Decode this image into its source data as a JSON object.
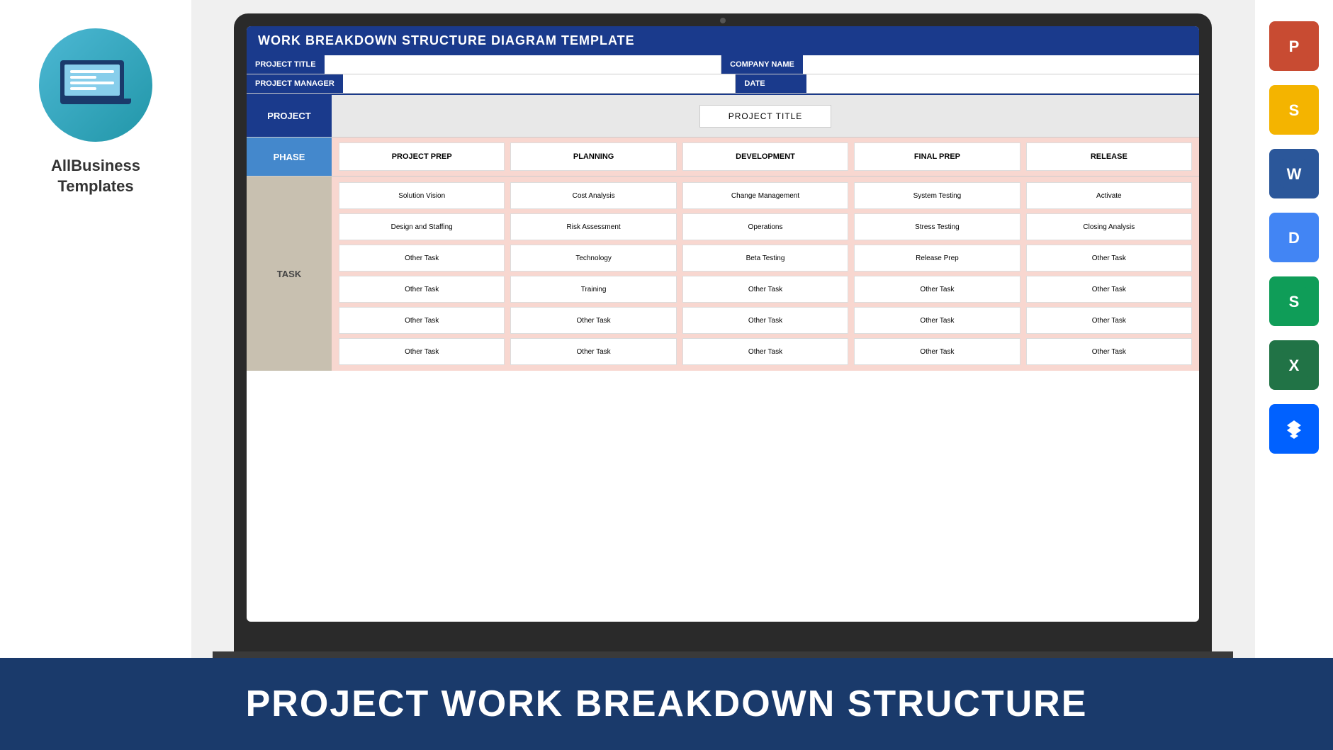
{
  "bottom_banner": {
    "text": "PROJECT WORK BREAKDOWN STRUCTURE"
  },
  "left_sidebar": {
    "brand_line1": "AllBusiness",
    "brand_line2": "Templates"
  },
  "right_sidebar": {
    "icons": [
      {
        "name": "powerpoint-icon",
        "label": "P",
        "class": "icon-ppt"
      },
      {
        "name": "google-slides-icon",
        "label": "S",
        "class": "icon-slides"
      },
      {
        "name": "word-icon",
        "label": "W",
        "class": "icon-word"
      },
      {
        "name": "google-docs-icon",
        "label": "D",
        "class": "icon-docs"
      },
      {
        "name": "google-sheets-icon",
        "label": "S",
        "class": "icon-sheets"
      },
      {
        "name": "excel-icon",
        "label": "X",
        "class": "icon-excel"
      },
      {
        "name": "dropbox-icon",
        "label": "✦",
        "class": "icon-dropbox"
      }
    ]
  },
  "wbs": {
    "title": "WORK BREAKDOWN STRUCTURE DIAGRAM TEMPLATE",
    "fields": {
      "project_title_label": "PROJECT TITLE",
      "project_title_value": "",
      "company_name_label": "COMPANY NAME",
      "company_name_value": "",
      "project_manager_label": "PROJECT MANAGER",
      "project_manager_value": "",
      "date_label": "DATE",
      "date_value": ""
    },
    "project_label": "PROJECT",
    "project_title": "PROJECT TITLE",
    "phase_label": "PHASE",
    "phases": [
      "PROJECT PREP",
      "PLANNING",
      "DEVELOPMENT",
      "FINAL PREP",
      "RELEASE"
    ],
    "task_label": "TASK",
    "task_columns": [
      [
        "Solution Vision",
        "Design and Staffing",
        "Other Task",
        "Other Task",
        "Other Task",
        "Other Task"
      ],
      [
        "Cost Analysis",
        "Risk Assessment",
        "Technology",
        "Training",
        "Other Task",
        "Other Task"
      ],
      [
        "Change Management",
        "Operations",
        "Beta Testing",
        "Other Task",
        "Other Task",
        "Other Task"
      ],
      [
        "System Testing",
        "Stress Testing",
        "Release Prep",
        "Other Task",
        "Other Task",
        "Other Task"
      ],
      [
        "Activate",
        "Closing Analysis",
        "Other Task",
        "Other Task",
        "Other Task",
        "Other Task"
      ]
    ]
  }
}
